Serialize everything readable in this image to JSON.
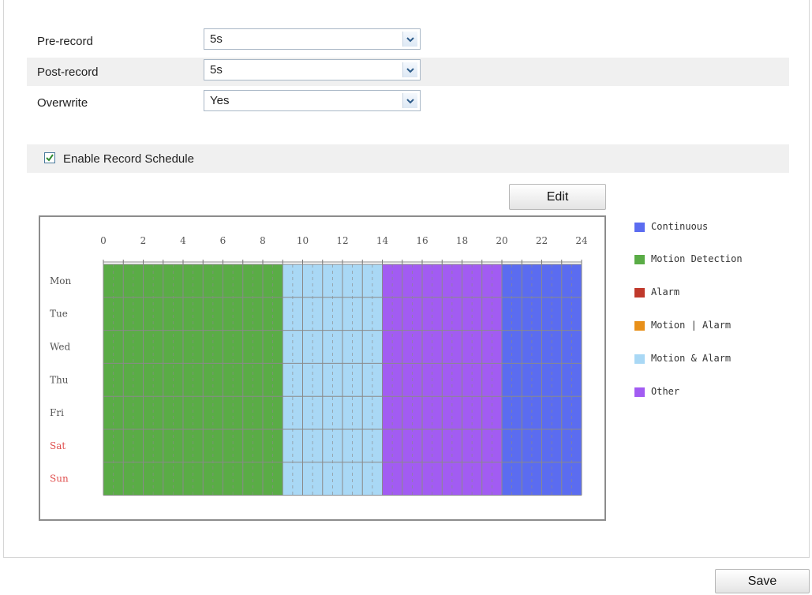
{
  "settings": {
    "pre_record": {
      "label": "Pre-record",
      "value": "5s"
    },
    "post_record": {
      "label": "Post-record",
      "value": "5s"
    },
    "overwrite": {
      "label": "Overwrite",
      "value": "Yes"
    }
  },
  "schedule": {
    "enable_label": "Enable Record Schedule",
    "enabled": true,
    "edit_label": "Edit",
    "hour_labels": [
      "0",
      "2",
      "4",
      "6",
      "8",
      "10",
      "12",
      "14",
      "16",
      "18",
      "20",
      "22",
      "24"
    ],
    "days": [
      {
        "label": "Mon",
        "weekend": false
      },
      {
        "label": "Tue",
        "weekend": false
      },
      {
        "label": "Wed",
        "weekend": false
      },
      {
        "label": "Thu",
        "weekend": false
      },
      {
        "label": "Fri",
        "weekend": false
      },
      {
        "label": "Sat",
        "weekend": true
      },
      {
        "label": "Sun",
        "weekend": true
      }
    ],
    "segments": [
      {
        "type": "motion_detection",
        "start": 0,
        "end": 9
      },
      {
        "type": "motion_and_alarm",
        "start": 9,
        "end": 14
      },
      {
        "type": "other",
        "start": 14,
        "end": 20
      },
      {
        "type": "continuous",
        "start": 20,
        "end": 24
      }
    ]
  },
  "legend": [
    {
      "key": "continuous",
      "label": "Continuous",
      "color": "#5b6cf0"
    },
    {
      "key": "motion_detection",
      "label": "Motion Detection",
      "color": "#5aac46"
    },
    {
      "key": "alarm",
      "label": "Alarm",
      "color": "#c0392b"
    },
    {
      "key": "motion_or_alarm",
      "label": "Motion | Alarm",
      "color": "#e8901a"
    },
    {
      "key": "motion_and_alarm",
      "label": "Motion & Alarm",
      "color": "#a9d8f5"
    },
    {
      "key": "other",
      "label": "Other",
      "color": "#a25cf2"
    }
  ],
  "colors": {
    "weekday_label": "#555555",
    "weekend_label": "#e0504f",
    "grid_line": "#8a8a8a"
  },
  "footer": {
    "save_label": "Save"
  }
}
